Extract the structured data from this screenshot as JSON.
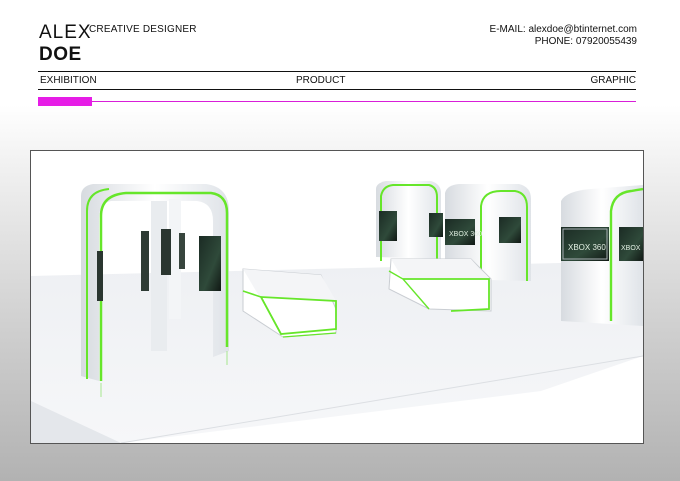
{
  "header": {
    "first_name": "ALEX",
    "last_name": "DOE",
    "role": "CREATIVE DESIGNER",
    "email": "E-MAIL: alexdoe@btinternet.com",
    "phone": "PHONE: 07920055439"
  },
  "nav": {
    "items": [
      "EXHIBITION",
      "PRODUCT",
      "GRAPHIC"
    ]
  },
  "progress": {
    "fraction": 0.09,
    "color": "#e61ce6"
  },
  "render": {
    "screen_label": "XBOX 360",
    "accent_color": "#66e62a"
  }
}
